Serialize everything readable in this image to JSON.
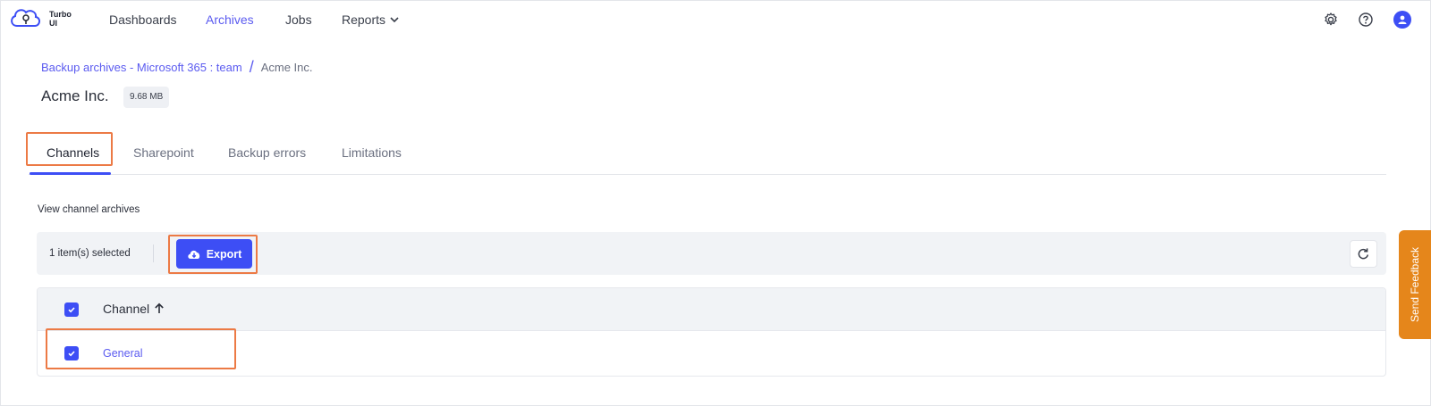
{
  "app": {
    "brand": "Turbo UI"
  },
  "nav": {
    "items": [
      {
        "label": "Dashboards",
        "active": false
      },
      {
        "label": "Archives",
        "active": true
      },
      {
        "label": "Jobs",
        "active": false
      },
      {
        "label": "Reports",
        "active": false,
        "has_dropdown": true
      }
    ],
    "icons": [
      "gear-icon",
      "help-icon",
      "user-avatar-icon"
    ]
  },
  "breadcrumb": {
    "parent": "Backup archives - Microsoft 365 : team",
    "separator": "/",
    "current": "Acme Inc."
  },
  "page": {
    "title": "Acme Inc.",
    "size_badge": "9.68 MB"
  },
  "tabs": [
    {
      "label": "Channels",
      "active": true
    },
    {
      "label": "Sharepoint",
      "active": false
    },
    {
      "label": "Backup errors",
      "active": false
    },
    {
      "label": "Limitations",
      "active": false
    }
  ],
  "section": {
    "label": "View channel archives"
  },
  "toolbar": {
    "selected_count": "1 item(s) selected",
    "export_label": "Export"
  },
  "table": {
    "columns": [
      {
        "label": "Channel",
        "sort": "ascending"
      }
    ],
    "header_checked": true,
    "rows": [
      {
        "channel": "General",
        "checked": true
      }
    ]
  },
  "feedback": {
    "label": "Send Feedback"
  },
  "colors": {
    "accent": "#3d4ef5",
    "link": "#5b5bf0",
    "highlight": "#ec7a45",
    "feedback": "#e5861b"
  }
}
